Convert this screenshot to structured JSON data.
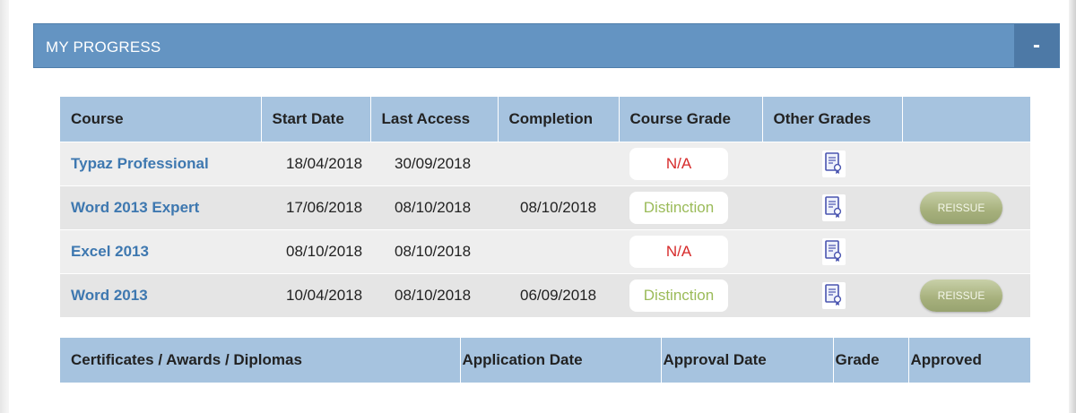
{
  "panel": {
    "title": "MY PROGRESS",
    "collapse_label": "-"
  },
  "courses_table": {
    "headers": [
      "Course",
      "Start Date",
      "Last Access",
      "Completion",
      "Course Grade",
      "Other Grades",
      ""
    ],
    "rows": [
      {
        "course": "Typaz Professional",
        "start_date": "18/04/2018",
        "last_access": "30/09/2018",
        "completion": "",
        "grade": "N/A",
        "grade_type": "na",
        "action": ""
      },
      {
        "course": "Word 2013 Expert",
        "start_date": "17/06/2018",
        "last_access": "08/10/2018",
        "completion": "08/10/2018",
        "grade": "Distinction",
        "grade_type": "distinction",
        "action": "REISSUE"
      },
      {
        "course": "Excel 2013",
        "start_date": "08/10/2018",
        "last_access": "08/10/2018",
        "completion": "",
        "grade": "N/A",
        "grade_type": "na",
        "action": ""
      },
      {
        "course": "Word 2013",
        "start_date": "10/04/2018",
        "last_access": "08/10/2018",
        "completion": "06/09/2018",
        "grade": "Distinction",
        "grade_type": "distinction",
        "action": "REISSUE"
      }
    ]
  },
  "certificates_table": {
    "headers": [
      "Certificates / Awards / Diplomas",
      "Application Date",
      "Approval Date",
      "Grade",
      "Approved"
    ]
  },
  "colors": {
    "header_bar": "#6494c2",
    "table_header": "#a6c3df",
    "course_link": "#3e78b0",
    "grade_na": "#d62a2a",
    "grade_distinction": "#9bbb59"
  },
  "icons": {
    "other_grades": "document-icon"
  }
}
